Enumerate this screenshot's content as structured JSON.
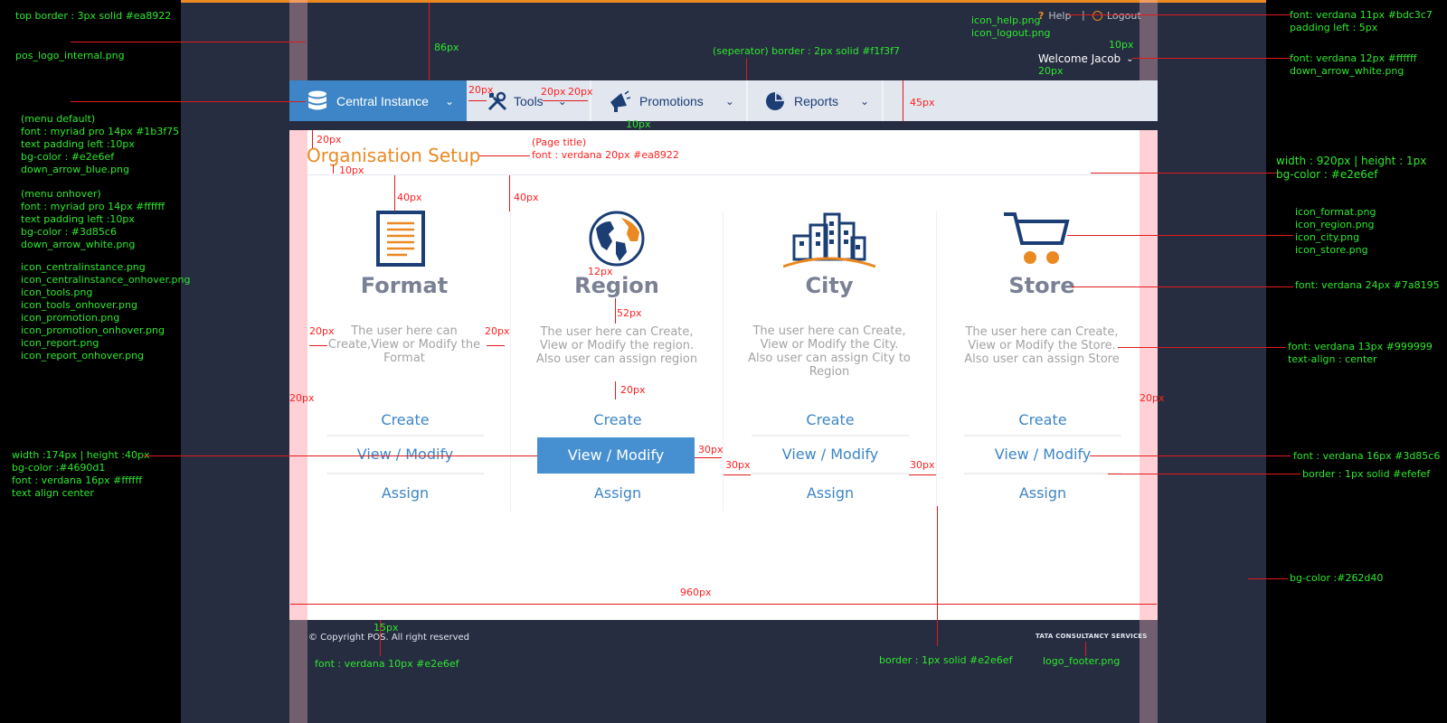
{
  "header": {
    "help_label": "Help",
    "divider": "|",
    "logout_label": "Logout",
    "welcome_text": "Welcome Jacob"
  },
  "menu": {
    "items": [
      {
        "label": "Central Instance",
        "icon": "database-icon",
        "active": true
      },
      {
        "label": "Tools",
        "icon": "tools-icon"
      },
      {
        "label": "Promotions",
        "icon": "megaphone-icon"
      },
      {
        "label": "Reports",
        "icon": "pie-chart-icon"
      }
    ]
  },
  "page": {
    "title": "Organisation Setup",
    "columns": [
      {
        "title": "Format",
        "icon": "format-icon",
        "description": "The user here can Create,View or Modify the Format",
        "actions": [
          "Create",
          "View / Modify",
          "Assign"
        ]
      },
      {
        "title": "Region",
        "icon": "globe-icon",
        "description": "The user here can Create, View or Modify the region. Also user can assign region",
        "actions": [
          "Create",
          "View / Modify",
          "Assign"
        ]
      },
      {
        "title": "City",
        "icon": "city-icon",
        "description": "The user here can Create, View or Modify the City. Also user can assign City to Region",
        "actions": [
          "Create",
          "View / Modify",
          "Assign"
        ]
      },
      {
        "title": "Store",
        "icon": "cart-icon",
        "description": "The user here can Create, View or Modify the Store. Also user can assign Store",
        "actions": [
          "Create",
          "View / Modify",
          "Assign"
        ]
      }
    ]
  },
  "footer": {
    "copyright": "© Copyright POS. All right reserved",
    "logo_text": "TATA CONSULTANCY SERVICES"
  },
  "colors": {
    "accent": "#ea8922",
    "menu_bg": "#e2e6ef",
    "menu_active_bg": "#3d85c6",
    "button_bg": "#4690d1",
    "page_bg": "#262d40",
    "link": "#3d85c6",
    "title_gray": "#7a8195",
    "desc_gray": "#999999"
  },
  "annotations": {
    "top_border": "top border : 3px solid #ea8922",
    "pos_logo": "pos_logo_internal.png",
    "menu_default": [
      "(menu default)",
      "font : myriad pro 14px #1b3f75",
      "text padding left :10px",
      "bg-color : #e2e6ef",
      "down_arrow_blue.png"
    ],
    "menu_onhover": [
      "(menu onhover)",
      "font : myriad pro 14px #ffffff",
      "text padding left :10px",
      "bg-color : #3d85c6",
      "down_arrow_white.png"
    ],
    "menu_icons": [
      "icon_centralinstance.png",
      "icon_centralinstance_onhover.png",
      "icon_tools.png",
      "icon_tools_onhover.png",
      "icon_promotion.png",
      "icon_promotion_onhover.png",
      "icon_report.png",
      "icon_report_onhover.png"
    ],
    "button_spec": [
      "width :174px | height :40px",
      "bg-color :#4690d1",
      "font : verdana 16px #ffffff",
      "text align center"
    ],
    "separator_spec": "(seperator) border : 2px solid #f1f3f7",
    "header_icons": [
      "icon_help.png",
      "icon_logout.png"
    ],
    "header_font": [
      "font: verdana 11px #bdc3c7",
      "padding left : 5px"
    ],
    "welcome_font": [
      "font: verdana 12px #ffffff",
      "down_arrow_white.png"
    ],
    "rule_spec": [
      "width : 920px | height : 1px",
      "bg-color : #e2e6ef"
    ],
    "icon_files": [
      "icon_format.png",
      "icon_region.png",
      "icon_city.png",
      "icon_store.png"
    ],
    "title_font": "font: verdana 24px #7a8195",
    "desc_font": [
      "font: verdana 13px #999999",
      "text-align : center"
    ],
    "link_font": "font : verdana 16px #3d85c6",
    "border_spec": "border : 1px solid #efefef",
    "bg_spec": "bg-color :#262d40",
    "footer_font": "font : verdana 10px #e2e6ef",
    "footer_border": "border : 1px solid #e2e6ef",
    "footer_logo": "logo_footer.png",
    "page_title_note": [
      "(Page title)",
      "font : verdana 20px #ea8922"
    ],
    "dims": {
      "d86": "86px",
      "d45": "45px",
      "d20": "20px",
      "d10": "10px",
      "d40": "40px",
      "d12": "12px",
      "d52": "52px",
      "d30": "30px",
      "d960": "960px",
      "d15": "15px"
    }
  }
}
